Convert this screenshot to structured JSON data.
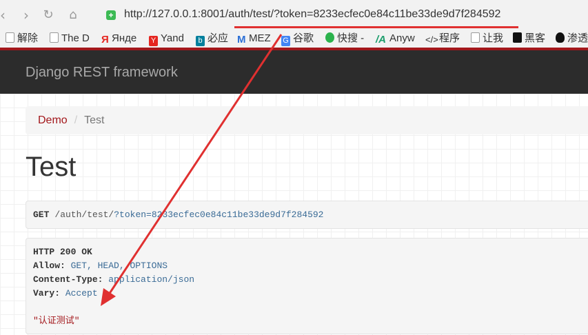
{
  "browser": {
    "url_host": "http://127.0.0.1:8001",
    "url_path": "/auth/test/?token=8233ecfec0e84c11be33de9d7f284592",
    "bookmarks": [
      {
        "label": "解除",
        "icon": "page-icon"
      },
      {
        "label": "The D",
        "icon": "page-icon"
      },
      {
        "label": "Янде",
        "icon": "yandex-icon",
        "color": "#e52620"
      },
      {
        "label": "Yand",
        "icon": "yandex-y-icon",
        "color": "#e52620"
      },
      {
        "label": "必应",
        "icon": "bing-icon",
        "color": "#00809d"
      },
      {
        "label": "MEZ",
        "icon": "mez-icon",
        "color": "#2b6fd6"
      },
      {
        "label": "谷歌",
        "icon": "google-icon",
        "color": "#4285f4"
      },
      {
        "label": "快搜 -",
        "icon": "kuaisou-icon",
        "color": "#2bb24c"
      },
      {
        "label": "Anyw",
        "icon": "anyw-icon",
        "color": "#1a9d6b"
      },
      {
        "label": "程序",
        "icon": "code-icon",
        "color": "#333333"
      },
      {
        "label": "让我",
        "icon": "page-icon"
      },
      {
        "label": "黑客",
        "icon": "hacker-icon",
        "color": "#111111"
      },
      {
        "label": "渗透",
        "icon": "shield-skull-icon",
        "color": "#111111"
      }
    ]
  },
  "navbar": {
    "brand": "Django REST framework"
  },
  "breadcrumb": {
    "link": "Demo",
    "separator": "/",
    "active": "Test"
  },
  "page": {
    "title": "Test"
  },
  "request": {
    "method": "GET",
    "path": "/auth/test/",
    "query": "?token=8233ecfec0e84c11be33de9d7f284592"
  },
  "response": {
    "status": "HTTP 200 OK",
    "headers": [
      {
        "key": "Allow:",
        "value": "GET, HEAD, OPTIONS"
      },
      {
        "key": "Content-Type:",
        "value": "application/json"
      },
      {
        "key": "Vary:",
        "value": "Accept"
      }
    ],
    "body": "\"认证测试\""
  },
  "colors": {
    "accent": "#a3171b",
    "annotation": "#e03030",
    "navbar_bg": "#2c2c2c"
  }
}
